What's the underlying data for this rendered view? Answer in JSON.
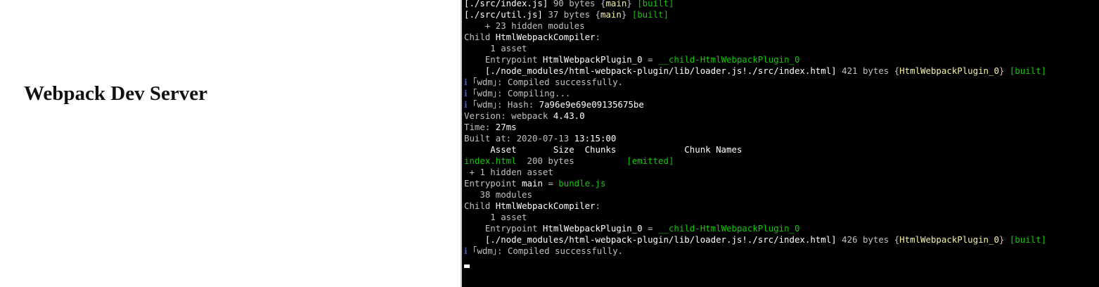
{
  "browser": {
    "heading": "Webpack Dev Server"
  },
  "terminal": {
    "colors": {
      "background": "#000000",
      "default": "#cccccc",
      "white": "#ffffff",
      "yellow": "#f9f1a5",
      "green": "#16c60c",
      "blue": "#3b5ea8"
    },
    "lines": [
      [
        {
          "t": "[./src/index.js] ",
          "c": "white"
        },
        {
          "t": "90 bytes {",
          "c": "gray"
        },
        {
          "t": "main",
          "c": "yellow"
        },
        {
          "t": "} ",
          "c": "gray"
        },
        {
          "t": "[built]",
          "c": "green"
        }
      ],
      [
        {
          "t": "[./src/util.js] ",
          "c": "white"
        },
        {
          "t": "37 bytes {",
          "c": "gray"
        },
        {
          "t": "main",
          "c": "yellow"
        },
        {
          "t": "} ",
          "c": "gray"
        },
        {
          "t": "[built]",
          "c": "green"
        }
      ],
      [
        {
          "t": "    + 23 hidden modules",
          "c": "gray"
        }
      ],
      [
        {
          "t": "Child ",
          "c": "gray"
        },
        {
          "t": "HtmlWebpackCompiler",
          "c": "white"
        },
        {
          "t": ":",
          "c": "gray"
        }
      ],
      [
        {
          "t": "     1 asset",
          "c": "gray"
        }
      ],
      [
        {
          "t": "    Entrypoint ",
          "c": "gray"
        },
        {
          "t": "HtmlWebpackPlugin_0",
          "c": "white"
        },
        {
          "t": " = ",
          "c": "gray"
        },
        {
          "t": "__child-HtmlWebpackPlugin_0",
          "c": "green"
        }
      ],
      [
        {
          "t": "    [./node_modules/html-webpack-plugin/lib/loader.js!./src/index.html] ",
          "c": "white"
        },
        {
          "t": "421 bytes {",
          "c": "gray"
        },
        {
          "t": "HtmlWebpackPlugin_0",
          "c": "yellow"
        },
        {
          "t": "} ",
          "c": "gray"
        },
        {
          "t": "[built]",
          "c": "green"
        }
      ],
      [
        {
          "t": "ℹ ",
          "c": "blue"
        },
        {
          "t": "｢wdm｣",
          "c": "gray"
        },
        {
          "t": ": Compiled successfully.",
          "c": "gray"
        }
      ],
      [
        {
          "t": "ℹ ",
          "c": "blue"
        },
        {
          "t": "｢wdm｣",
          "c": "gray"
        },
        {
          "t": ": Compiling...",
          "c": "gray"
        }
      ],
      [
        {
          "t": "ℹ ",
          "c": "blue"
        },
        {
          "t": "｢wdm｣",
          "c": "gray"
        },
        {
          "t": ": Hash: ",
          "c": "gray"
        },
        {
          "t": "7a96e9e69e09135675be",
          "c": "white"
        }
      ],
      [
        {
          "t": "Version: webpack ",
          "c": "gray"
        },
        {
          "t": "4.43.0",
          "c": "white"
        }
      ],
      [
        {
          "t": "Time: ",
          "c": "gray"
        },
        {
          "t": "27",
          "c": "white"
        },
        {
          "t": "ms",
          "c": "white"
        }
      ],
      [
        {
          "t": "Built at: 2020-07-13 ",
          "c": "gray"
        },
        {
          "t": "13:15:00",
          "c": "white"
        }
      ],
      [
        {
          "t": "     Asset       Size  Chunks             Chunk Names",
          "c": "white"
        }
      ],
      [
        {
          "t": "index.html",
          "c": "green"
        },
        {
          "t": "  200 bytes          ",
          "c": "gray"
        },
        {
          "t": "[emitted]",
          "c": "green"
        }
      ],
      [
        {
          "t": " + 1 hidden asset",
          "c": "gray"
        }
      ],
      [
        {
          "t": "Entrypoint ",
          "c": "gray"
        },
        {
          "t": "main",
          "c": "white"
        },
        {
          "t": " = ",
          "c": "gray"
        },
        {
          "t": "bundle.js",
          "c": "green"
        }
      ],
      [
        {
          "t": "   38 modules",
          "c": "gray"
        }
      ],
      [
        {
          "t": "Child ",
          "c": "gray"
        },
        {
          "t": "HtmlWebpackCompiler",
          "c": "white"
        },
        {
          "t": ":",
          "c": "gray"
        }
      ],
      [
        {
          "t": "     1 asset",
          "c": "gray"
        }
      ],
      [
        {
          "t": "    Entrypoint ",
          "c": "gray"
        },
        {
          "t": "HtmlWebpackPlugin_0",
          "c": "white"
        },
        {
          "t": " = ",
          "c": "gray"
        },
        {
          "t": "__child-HtmlWebpackPlugin_0",
          "c": "green"
        }
      ],
      [
        {
          "t": "    [./node_modules/html-webpack-plugin/lib/loader.js!./src/index.html] ",
          "c": "white"
        },
        {
          "t": "426 bytes {",
          "c": "gray"
        },
        {
          "t": "HtmlWebpackPlugin_0",
          "c": "yellow"
        },
        {
          "t": "} ",
          "c": "gray"
        },
        {
          "t": "[built]",
          "c": "green"
        }
      ],
      [
        {
          "t": "ℹ ",
          "c": "blue"
        },
        {
          "t": "｢wdm｣",
          "c": "gray"
        },
        {
          "t": ": Compiled successfully.",
          "c": "gray"
        }
      ]
    ]
  }
}
